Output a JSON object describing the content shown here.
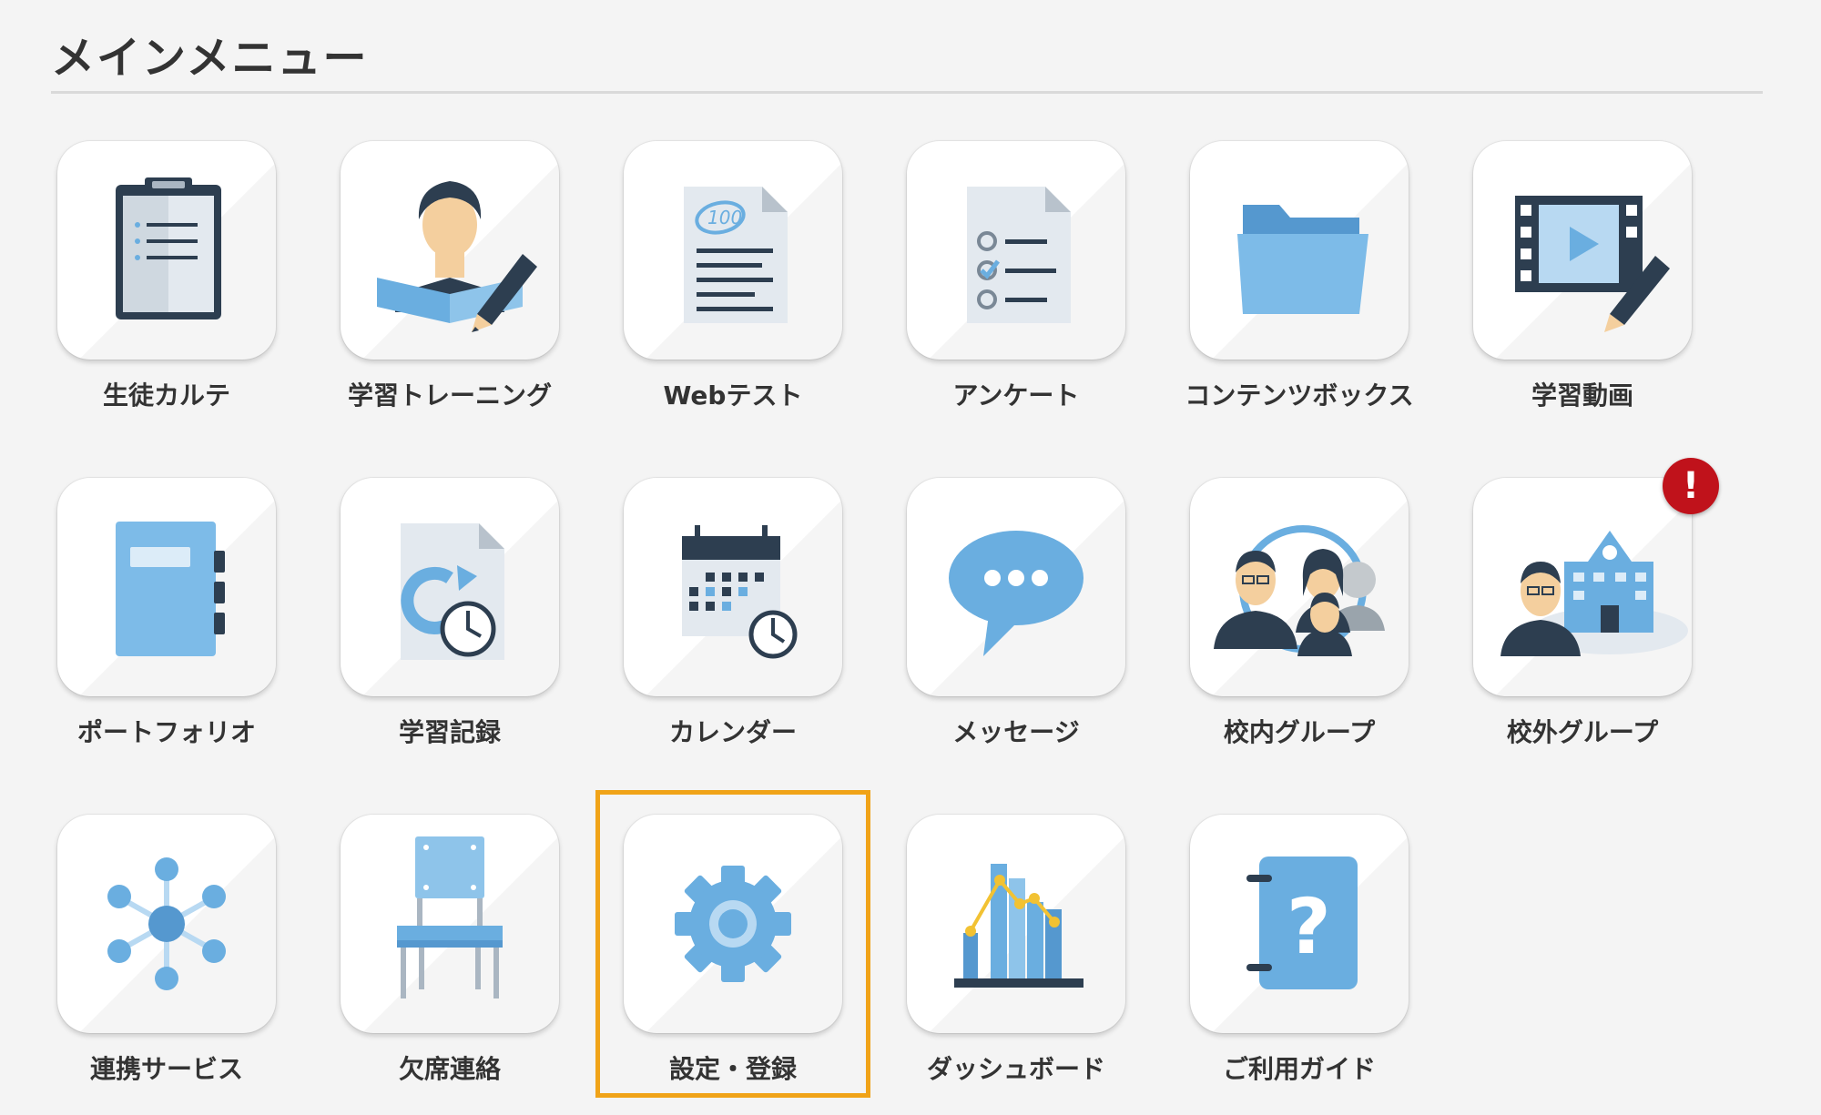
{
  "header": {
    "title": "メインメニュー"
  },
  "menu": {
    "items": [
      {
        "label": "生徒カルテ",
        "icon": "clipboard-icon"
      },
      {
        "label": "学習トレーニング",
        "icon": "student-writing-icon"
      },
      {
        "label": "Webテスト",
        "icon": "test-paper-icon"
      },
      {
        "label": "アンケート",
        "icon": "checklist-icon"
      },
      {
        "label": "コンテンツボックス",
        "icon": "folder-icon"
      },
      {
        "label": "学習動画",
        "icon": "video-edit-icon"
      },
      {
        "label": "ポートフォリオ",
        "icon": "notebook-icon"
      },
      {
        "label": "学習記録",
        "icon": "document-clock-icon"
      },
      {
        "label": "カレンダー",
        "icon": "calendar-clock-icon"
      },
      {
        "label": "メッセージ",
        "icon": "speech-bubble-icon"
      },
      {
        "label": "校内グループ",
        "icon": "group-people-icon"
      },
      {
        "label": "校外グループ",
        "icon": "school-person-icon"
      },
      {
        "label": "連携サービス",
        "icon": "network-hub-icon"
      },
      {
        "label": "欠席連絡",
        "icon": "chair-icon"
      },
      {
        "label": "設定・登録",
        "icon": "gear-icon"
      },
      {
        "label": "ダッシュボード",
        "icon": "bar-chart-icon"
      },
      {
        "label": "ご利用ガイド",
        "icon": "help-book-icon"
      }
    ]
  },
  "alert_badge": {
    "text": "!"
  },
  "colors": {
    "icon_blue": "#6aaee0",
    "icon_dark": "#2d3e50",
    "badge_red": "#c0121b",
    "selection_orange": "#f0a318"
  }
}
